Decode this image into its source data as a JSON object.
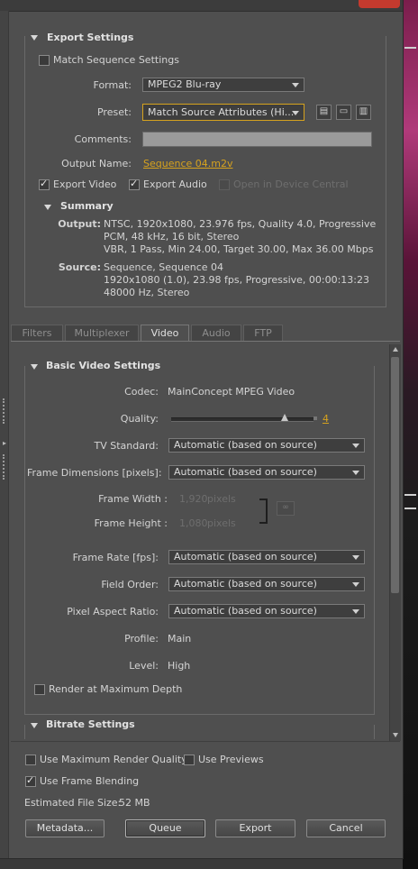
{
  "export_settings": {
    "title": "Export Settings",
    "match_sequence_label": "Match Sequence Settings",
    "match_sequence_checked": false,
    "format_label": "Format:",
    "format_value": "MPEG2 Blu-ray",
    "preset_label": "Preset:",
    "preset_value": "Match Source Attributes (Hi...",
    "comments_label": "Comments:",
    "comments_value": "",
    "output_name_label": "Output Name:",
    "output_name_value": "Sequence 04.m2v",
    "export_video_label": "Export Video",
    "export_video_checked": true,
    "export_audio_label": "Export Audio",
    "export_audio_checked": true,
    "open_device_label": "Open in Device Central",
    "open_device_checked": false
  },
  "summary": {
    "title": "Summary",
    "output_label": "Output:",
    "output_lines": [
      "NTSC, 1920x1080, 23.976 fps, Quality 4.0, Progressive",
      "PCM, 48 kHz, 16 bit, Stereo",
      "VBR, 1 Pass, Min 24.00, Target 30.00, Max 36.00 Mbps"
    ],
    "source_label": "Source:",
    "source_lines": [
      "Sequence, Sequence 04",
      "1920x1080 (1.0), 23.98 fps, Progressive, 00:00:13:23",
      "48000 Hz, Stereo"
    ]
  },
  "tabs": [
    "Filters",
    "Multiplexer",
    "Video",
    "Audio",
    "FTP"
  ],
  "active_tab": "Video",
  "basic_video": {
    "title": "Basic Video Settings",
    "codec_label": "Codec:",
    "codec_value": "MainConcept MPEG Video",
    "quality_label": "Quality:",
    "quality_value": "4",
    "quality_fraction": 0.8,
    "tv_standard_label": "TV Standard:",
    "tv_standard_value": "Automatic (based on source)",
    "frame_dims_label": "Frame Dimensions [pixels]:",
    "frame_dims_value": "Automatic (based on source)",
    "frame_width_label": "Frame Width :",
    "frame_width_value": "1,920",
    "frame_height_label": "Frame Height :",
    "frame_height_value": "1,080",
    "pixels_unit": "pixels",
    "frame_rate_label": "Frame Rate [fps]:",
    "frame_rate_value": "Automatic (based on source)",
    "field_order_label": "Field Order:",
    "field_order_value": "Automatic (based on source)",
    "pixel_aspect_label": "Pixel Aspect Ratio:",
    "pixel_aspect_value": "Automatic (based on source)",
    "profile_label": "Profile:",
    "profile_value": "Main",
    "level_label": "Level:",
    "level_value": "High",
    "render_max_depth_label": "Render at Maximum Depth",
    "render_max_depth_checked": false
  },
  "bitrate": {
    "title": "Bitrate Settings"
  },
  "bottom": {
    "max_render_quality_label": "Use Maximum Render Quality",
    "max_render_quality_checked": false,
    "use_previews_label": "Use Previews",
    "use_previews_checked": false,
    "frame_blending_label": "Use Frame Blending",
    "frame_blending_checked": true,
    "file_size_label": "Estimated File Size:",
    "file_size_value": "52 MB"
  },
  "buttons": {
    "metadata": "Metadata...",
    "queue": "Queue",
    "export": "Export",
    "cancel": "Cancel"
  },
  "colors": {
    "accent": "#d6a21e",
    "panel": "#4f4f4f",
    "close": "#c43a2e"
  }
}
